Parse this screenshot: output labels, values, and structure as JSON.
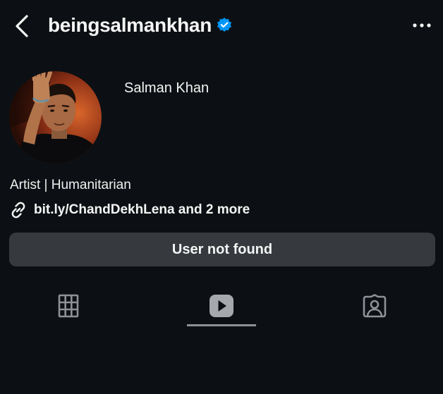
{
  "header": {
    "username": "beingsalmankhan",
    "verified": true,
    "back_icon": "chevron-left-icon",
    "more_icon": "more-horizontal-icon"
  },
  "profile": {
    "display_name": "Salman Khan",
    "bio": "Artist | Humanitarian",
    "link_icon": "link-icon",
    "link_text": "bit.ly/ChandDekhLena and 2 more"
  },
  "action_button": {
    "label": "User not found"
  },
  "tabs": [
    {
      "name": "posts",
      "icon": "grid-icon",
      "active": false
    },
    {
      "name": "reels",
      "icon": "reels-play-icon",
      "active": true
    },
    {
      "name": "tagged",
      "icon": "tagged-person-icon",
      "active": false
    }
  ],
  "colors": {
    "background": "#0c1014",
    "button_bg": "#363a3f",
    "verified_blue": "#0095f6",
    "icon_gray": "#8e9196"
  }
}
